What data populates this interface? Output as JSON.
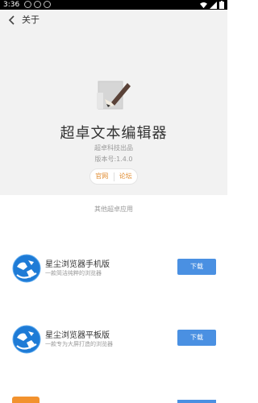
{
  "status_bar": {
    "time": "3:36"
  },
  "app_bar": {
    "back_icon": "chevron-left-icon",
    "title": "关于"
  },
  "header": {
    "logo_icon": "pen-document-icon",
    "app_name": "超卓文本编辑器",
    "company": "超卓科技出品",
    "version": "版本号:1.4.0",
    "links": [
      "官网",
      "论坛"
    ],
    "link_color": "#e08a2c"
  },
  "other_apps": {
    "title": "其他超卓应用",
    "download_color": "#4a90e2",
    "items": [
      {
        "name": "星尘浏览器手机版",
        "desc": "一款简洁纯粹的浏览器",
        "button": "下载",
        "icon": "globe-browser-icon"
      },
      {
        "name": "星尘浏览器平板版",
        "desc": "一款专为大屏打造的浏览器",
        "button": "下载",
        "icon": "globe-browser-icon"
      }
    ]
  }
}
